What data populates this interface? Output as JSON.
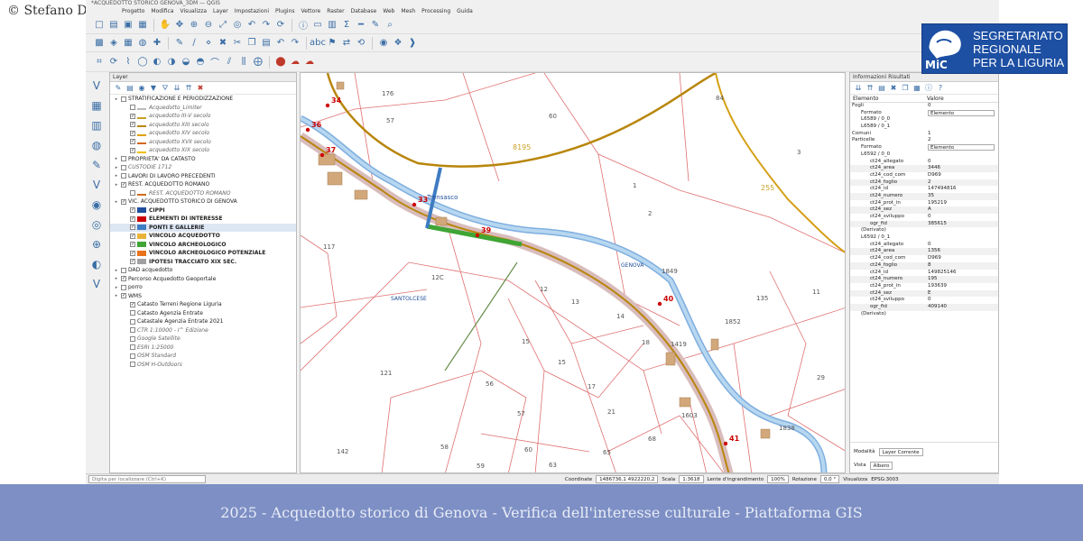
{
  "copyright": "© Stefano Di Meo",
  "banner": "2025 - Acquedotto storico di Genova - Verifica dell'interesse culturale - Piattaforma GIS",
  "logo": {
    "line1": "SEGRETARIATO",
    "line2": "REGIONALE",
    "line3": "PER LA LIGURIA",
    "mark": "MiC"
  },
  "window": {
    "title": "*ACQUEDOTTO STORICO GENOVA_3DM — QGIS"
  },
  "menu": [
    "Progetto",
    "Modifica",
    "Visualizza",
    "Layer",
    "Impostazioni",
    "Plugins",
    "Vettore",
    "Raster",
    "Database",
    "Web",
    "Mesh",
    "Processing",
    "Guida"
  ],
  "layer_panel": {
    "title": "Layer",
    "items": [
      {
        "label": "STRATIFICAZIONE E PERIODIZZAZIONE",
        "level": 0,
        "checked": false,
        "style": "normal",
        "color": ""
      },
      {
        "label": "Acquedotto_Limiter",
        "level": 1,
        "checked": false,
        "style": "italic",
        "color": "#bbbbbb"
      },
      {
        "label": "acquedotto III-V secolo",
        "level": 1,
        "checked": true,
        "style": "italic",
        "color": "#c9a227"
      },
      {
        "label": "acquedotto XIII secolo",
        "level": 1,
        "checked": true,
        "style": "italic",
        "color": "#b8860b"
      },
      {
        "label": "acquedotto XIV secolo",
        "level": 1,
        "checked": true,
        "style": "italic",
        "color": "#e0a000"
      },
      {
        "label": "acquedotto XVII secolo",
        "level": 1,
        "checked": true,
        "style": "italic",
        "color": "#d2691e"
      },
      {
        "label": "acquedotto XIX secolo",
        "level": 1,
        "checked": true,
        "style": "italic",
        "color": "#f0c000"
      },
      {
        "label": "PROPRIETA' DA CATASTO",
        "level": 0,
        "checked": false,
        "style": "normal",
        "color": ""
      },
      {
        "label": "CUSTODIE 1712",
        "level": 0,
        "checked": false,
        "style": "italic",
        "color": ""
      },
      {
        "label": "LAVORI DI LAVORO PRECEDENTI",
        "level": 0,
        "checked": false,
        "style": "normal",
        "color": ""
      },
      {
        "label": "REST. ACQUEDOTTO ROMANO",
        "level": 0,
        "checked": true,
        "style": "normal",
        "color": ""
      },
      {
        "label": "REST. ACQUEDOTTO ROMANO",
        "level": 1,
        "checked": false,
        "style": "italic",
        "color": "#d2691e"
      },
      {
        "label": "VIC. ACQUEDOTTO STORICO DI GENOVA",
        "level": 0,
        "checked": true,
        "style": "normal",
        "color": ""
      },
      {
        "label": "CIPPI",
        "level": 1,
        "checked": true,
        "style": "bold",
        "color": "#1f4e9c"
      },
      {
        "label": "ELEMENTI DI INTERESSE",
        "level": 1,
        "checked": true,
        "style": "bold",
        "color": "#cc0000"
      },
      {
        "label": "PONTI E GALLERIE",
        "level": 1,
        "checked": true,
        "style": "bold",
        "color": "#3e7cc2"
      },
      {
        "label": "VINCOLO ACQUEDOTTO",
        "level": 1,
        "checked": true,
        "style": "bold",
        "color": "#e9b33a"
      },
      {
        "label": "VINCOLO ARCHEOLOGICO",
        "level": 1,
        "checked": true,
        "style": "bold",
        "color": "#3fa535"
      },
      {
        "label": "VINCOLO ARCHEOLOGICO POTENZIALE",
        "level": 1,
        "checked": true,
        "style": "bold",
        "color": "#e8731b"
      },
      {
        "label": "IPOTESI TRACCIATO XIX SEC.",
        "level": 1,
        "checked": true,
        "style": "bold",
        "color": "#a0a0a0"
      },
      {
        "label": "DAD acquedotto",
        "level": 0,
        "checked": false,
        "style": "normal",
        "color": ""
      },
      {
        "label": "Percorso Acquedotto Geoportale",
        "level": 0,
        "checked": true,
        "style": "normal",
        "color": ""
      },
      {
        "label": "porro",
        "level": 0,
        "checked": false,
        "style": "normal",
        "color": ""
      },
      {
        "label": "WMS",
        "level": 0,
        "checked": true,
        "style": "normal",
        "color": ""
      },
      {
        "label": "Catasto Terreni Regione Liguria",
        "level": 1,
        "checked": true,
        "style": "normal",
        "color": ""
      },
      {
        "label": "Catasto Agenzia Entrate",
        "level": 1,
        "checked": false,
        "style": "normal",
        "color": ""
      },
      {
        "label": "Catastale Agenzia Entrate 2021",
        "level": 1,
        "checked": false,
        "style": "normal",
        "color": ""
      },
      {
        "label": "CTR 1:10000 - I^ Edizione",
        "level": 1,
        "checked": false,
        "style": "italic",
        "color": ""
      },
      {
        "label": "Google Satellite",
        "level": 1,
        "checked": false,
        "style": "italic",
        "color": ""
      },
      {
        "label": "ESRI 1:25000",
        "level": 1,
        "checked": false,
        "style": "italic",
        "color": ""
      },
      {
        "label": "OSM Standard",
        "level": 1,
        "checked": false,
        "style": "italic",
        "color": ""
      },
      {
        "label": "OSM H-Outdoors",
        "level": 1,
        "checked": false,
        "style": "italic",
        "color": ""
      }
    ]
  },
  "map": {
    "parcels": [
      "176",
      "57",
      "60",
      "8195",
      "84",
      "3",
      "255",
      "2",
      "1",
      "117",
      "12C",
      "12",
      "13",
      "14",
      "15",
      "15",
      "17",
      "21",
      "18",
      "1419",
      "1852",
      "135",
      "11",
      "29",
      "1838",
      "1603",
      "68",
      "65",
      "63",
      "60",
      "58",
      "57",
      "56",
      "59",
      "142",
      "121",
      "1849"
    ],
    "points": [
      "34",
      "36",
      "37",
      "33",
      "39",
      "40",
      "41"
    ],
    "labels": {
      "river1": "GENOVA",
      "river2": "GENOVA",
      "place1": "Trensasco",
      "place2": "SANTOLCESE"
    }
  },
  "info_panel": {
    "title": "Informazioni Risultati",
    "col_element": "Elemento",
    "col_value": "Valore",
    "rows": [
      {
        "k": "Fogli",
        "v": "0",
        "hl": false,
        "select": false
      },
      {
        "k": "Formato",
        "v": "Elemento",
        "hl": false,
        "select": true
      },
      {
        "k": "L6589 / 0_0",
        "v": "",
        "hl": false,
        "select": false
      },
      {
        "k": "L6589 / 0_1",
        "v": "",
        "hl": false,
        "select": false
      },
      {
        "k": "Comuni",
        "v": "1",
        "hl": false,
        "select": false
      },
      {
        "k": "Particelle",
        "v": "2",
        "hl": false,
        "select": false
      },
      {
        "k": "Formato",
        "v": "Elemento",
        "hl": false,
        "select": true
      },
      {
        "k": "L6592 / 0_0",
        "v": "",
        "hl": false,
        "select": false
      },
      {
        "k": "ct24_allegato",
        "v": "0",
        "hl": false,
        "select": false
      },
      {
        "k": "ct24_area",
        "v": "3446",
        "hl": true,
        "select": false
      },
      {
        "k": "ct24_cod_com",
        "v": "D969",
        "hl": false,
        "select": false
      },
      {
        "k": "ct24_foglio",
        "v": "2",
        "hl": true,
        "select": false
      },
      {
        "k": "ct24_id",
        "v": "147494816",
        "hl": false,
        "select": false
      },
      {
        "k": "ct24_numero",
        "v": "35",
        "hl": true,
        "select": false
      },
      {
        "k": "ct24_prot_in",
        "v": "195219",
        "hl": false,
        "select": false
      },
      {
        "k": "ct24_sez",
        "v": "A",
        "hl": true,
        "select": false
      },
      {
        "k": "ct24_sviluppo",
        "v": "0",
        "hl": false,
        "select": false
      },
      {
        "k": "ogr_fid",
        "v": "385615",
        "hl": true,
        "select": false
      },
      {
        "k": "(Derivato)",
        "v": "",
        "hl": false,
        "select": false
      },
      {
        "k": "L6592 / 0_1",
        "v": "",
        "hl": false,
        "select": false
      },
      {
        "k": "ct24_allegato",
        "v": "0",
        "hl": false,
        "select": false
      },
      {
        "k": "ct24_area",
        "v": "1356",
        "hl": true,
        "select": false
      },
      {
        "k": "ct24_cod_com",
        "v": "D969",
        "hl": false,
        "select": false
      },
      {
        "k": "ct24_foglio",
        "v": "8",
        "hl": true,
        "select": false
      },
      {
        "k": "ct24_id",
        "v": "149825146",
        "hl": false,
        "select": false
      },
      {
        "k": "ct24_numero",
        "v": "195",
        "hl": true,
        "select": false
      },
      {
        "k": "ct24_prot_in",
        "v": "193639",
        "hl": false,
        "select": false
      },
      {
        "k": "ct24_sez",
        "v": "E",
        "hl": true,
        "select": false
      },
      {
        "k": "ct24_sviluppo",
        "v": "0",
        "hl": false,
        "select": false
      },
      {
        "k": "ogr_fid",
        "v": "409140",
        "hl": true,
        "select": false
      },
      {
        "k": "(Derivato)",
        "v": "",
        "hl": false,
        "select": false
      }
    ],
    "mode_label": "Modalità",
    "mode_value": "Layer Corrente",
    "view_label": "Vista",
    "view_value": "Albero"
  },
  "status": {
    "search_placeholder": "Digita per localizzare (Ctrl+K)",
    "coord_label": "Coordinate",
    "coord_value": "1486736,1 4922220,2",
    "scale_label": "Scala",
    "scale_value": "1:3618",
    "magnifier_label": "Lente d'ingrandimento",
    "magnifier_value": "100%",
    "rotation_label": "Rotazione",
    "rotation_value": "0,0 °",
    "render_label": "Visualizza",
    "crs": "EPSG:3003"
  }
}
